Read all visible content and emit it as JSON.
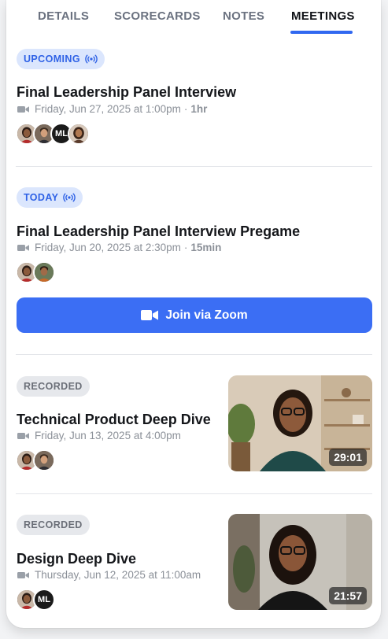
{
  "tabs": [
    {
      "label": "DETAILS"
    },
    {
      "label": "SCORECARDS"
    },
    {
      "label": "NOTES"
    },
    {
      "label": "MEETINGS",
      "active": true
    }
  ],
  "meetings": [
    {
      "badge": "UPCOMING",
      "title": "Final Leadership Panel Interview",
      "datetime": "Friday, Jun 27, 2025 at 1:00pm",
      "duration": "1hr",
      "attendees": [
        "avatar-1",
        "avatar-2",
        "ML",
        "avatar-4"
      ]
    },
    {
      "badge": "TODAY",
      "title": "Final Leadership Panel Interview Pregame",
      "datetime": "Friday, Jun 20, 2025 at 2:30pm",
      "duration": "15min",
      "attendees": [
        "avatar-1",
        "avatar-2"
      ],
      "join_label": "Join via Zoom"
    },
    {
      "badge": "RECORDED",
      "title": "Technical Product Deep Dive",
      "datetime": "Friday, Jun 13, 2025 at 4:00pm",
      "attendees": [
        "avatar-1",
        "avatar-2"
      ],
      "video_duration": "29:01"
    },
    {
      "badge": "RECORDED",
      "title": "Design Deep Dive",
      "datetime": "Thursday, Jun 12, 2025 at 11:00am",
      "attendees": [
        "avatar-1",
        "ML"
      ],
      "video_duration": "21:57"
    }
  ],
  "colors": {
    "accent": "#3b6ef4",
    "badge_blue_bg": "#dbe6fd",
    "badge_gray_bg": "#e6e8ec",
    "meta_text": "#8b9098"
  },
  "icons": {
    "live": "broadcast-icon",
    "camera": "video-camera-icon"
  },
  "initials": {
    "ml": "ML"
  }
}
